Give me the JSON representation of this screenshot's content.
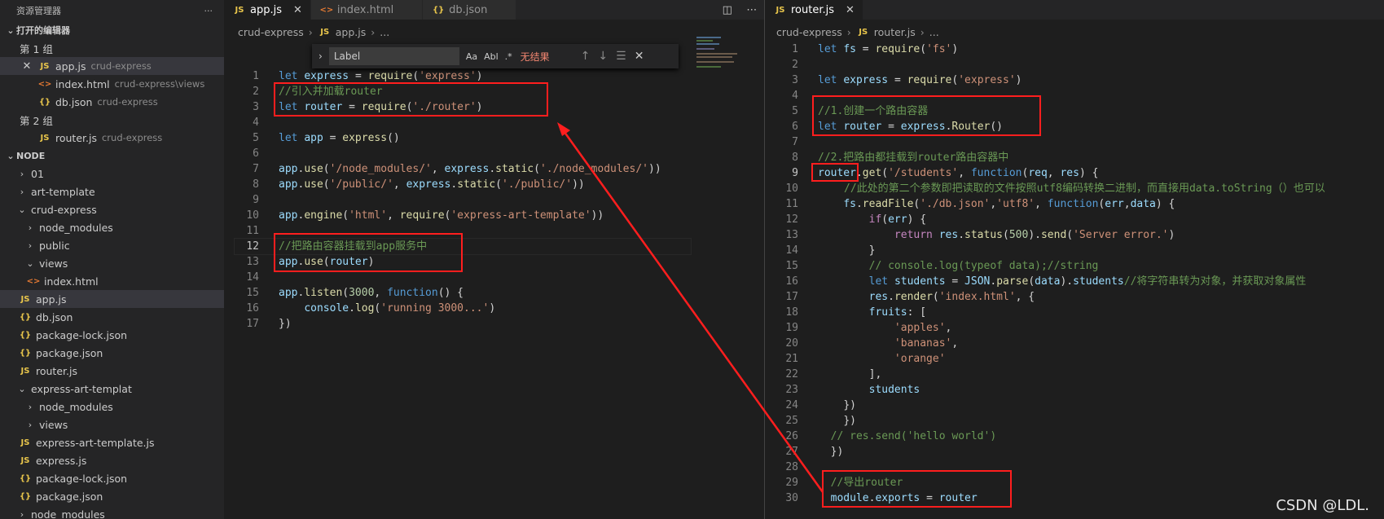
{
  "sidebar": {
    "title": "资源管理器",
    "more": "···",
    "open_editors": {
      "label": "打开的编辑器",
      "group1": "第 1 组",
      "group1_items": [
        {
          "name": "app.js",
          "desc": "crud-express"
        },
        {
          "name": "index.html",
          "desc": "crud-express\\views"
        },
        {
          "name": "db.json",
          "desc": "crud-express"
        }
      ],
      "group2": "第 2 组",
      "group2_items": [
        {
          "name": "router.js",
          "desc": "crud-express"
        }
      ]
    },
    "node_section": "NODE",
    "tree": [
      "01",
      "art-template",
      "crud-express",
      "node_modules",
      "public",
      "views",
      "index.html",
      "app.js",
      "db.json",
      "package-lock.json",
      "package.json",
      "router.js",
      "express-art-templat",
      "node_modules",
      "views",
      "express-art-template.js",
      "express.js",
      "package-lock.json",
      "package.json",
      "node_modules"
    ]
  },
  "left_editor": {
    "tabs": [
      "app.js",
      "index.html",
      "db.json"
    ],
    "breadcrumb": [
      "crud-express",
      "app.js",
      "..."
    ],
    "find": {
      "value": "Label",
      "opt1": "Aa",
      "opt2": "Abl",
      "opt3": ".*",
      "no_results": "无结果"
    },
    "lines": [
      "1",
      "2",
      "3",
      "4",
      "5",
      "6",
      "7",
      "8",
      "9",
      "10",
      "11",
      "12",
      "13",
      "14",
      "15",
      "16",
      "17"
    ]
  },
  "right_editor": {
    "tab": "router.js",
    "breadcrumb": [
      "crud-express",
      "router.js",
      "..."
    ],
    "lines": [
      "1",
      "2",
      "3",
      "4",
      "5",
      "6",
      "7",
      "8",
      "9",
      "10",
      "11",
      "12",
      "13",
      "14",
      "15",
      "16",
      "17",
      "18",
      "19",
      "20",
      "21",
      "22",
      "23",
      "24",
      "25",
      "26",
      "27",
      "28",
      "29",
      "30"
    ]
  },
  "code_text": {
    "l2": "//引入并加载router",
    "l12": "//把路由容器挂载到app服务中",
    "r5": "//1.创建一个路由容器",
    "r8": "//2.把路由都挂载到router路由容器中",
    "r10": "//此处的第二个参数即把读取的文件按照utf8编码转换二进制，而直接用data.toString（）也可以",
    "r17": "//将字符串转为对象，并获取对象属性",
    "r29": "//导出router"
  },
  "watermark": "CSDN @LDL.",
  "colors": {
    "annotation": "#ff1e1e",
    "background": "#1e1e1e",
    "sidebar": "#252526"
  }
}
